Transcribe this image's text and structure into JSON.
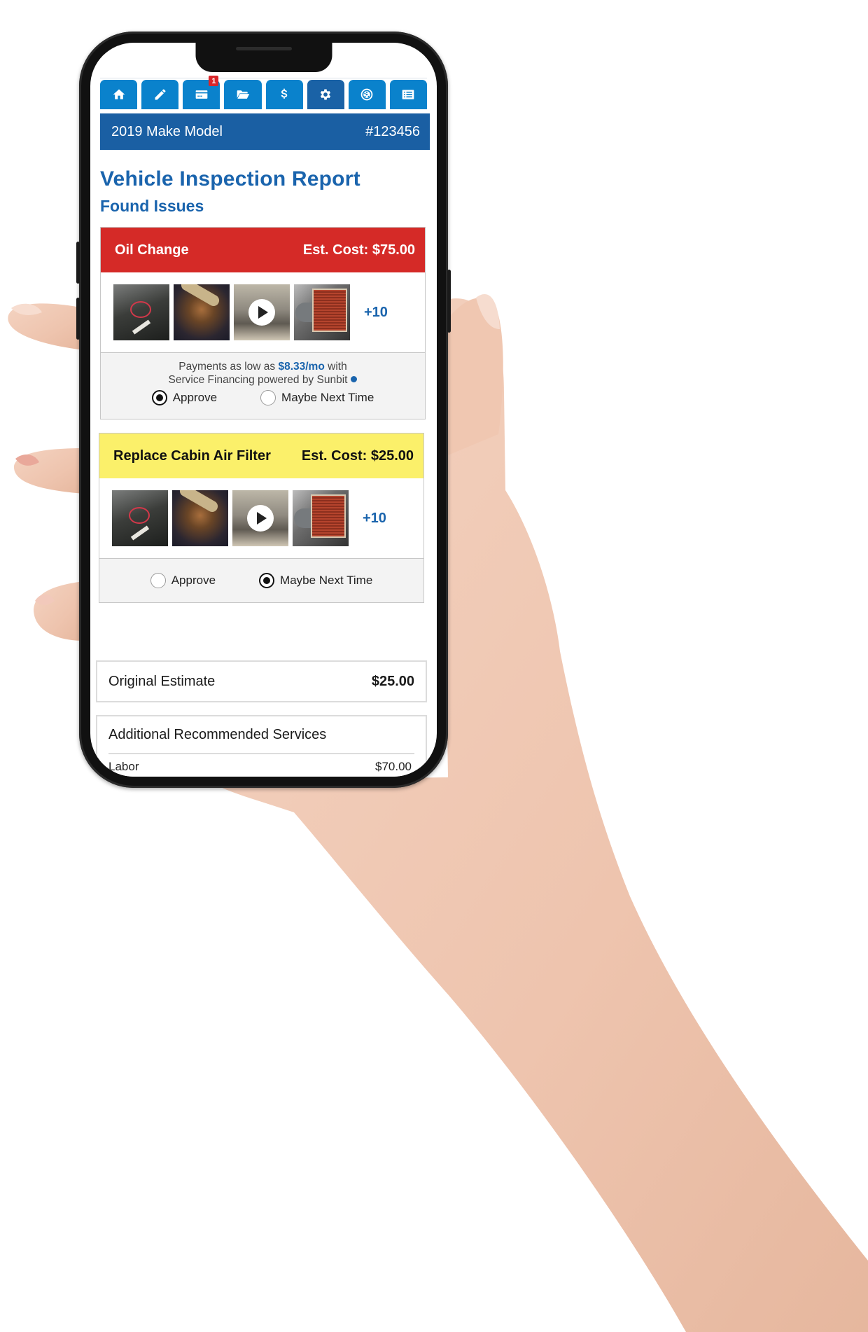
{
  "nav": {
    "tabs": [
      {
        "icon": "home-icon",
        "active": false,
        "badge": null
      },
      {
        "icon": "pencil-icon",
        "active": false,
        "badge": null
      },
      {
        "icon": "credit-card-icon",
        "active": false,
        "badge": "1"
      },
      {
        "icon": "folder-open-icon",
        "active": false,
        "badge": null
      },
      {
        "icon": "dollar-icon",
        "active": false,
        "badge": null
      },
      {
        "icon": "gear-icon",
        "active": true,
        "badge": null
      },
      {
        "icon": "tire-icon",
        "active": false,
        "badge": null
      },
      {
        "icon": "list-icon",
        "active": false,
        "badge": null
      }
    ]
  },
  "vehicle": {
    "name": "2019 Make Model",
    "order_number": "#123456"
  },
  "page": {
    "title": "Vehicle Inspection Report",
    "subtitle": "Found Issues"
  },
  "issues": [
    {
      "name": "Oil Change",
      "cost": "Est. Cost: $75.00",
      "severity": "red",
      "severity_color": "#d52a27",
      "media_more": "+10",
      "financing": {
        "line1_prefix": "Payments as low as",
        "amount": "$8.33/mo",
        "line1_suffix": "with",
        "line2": "Service Financing powered by Sunbit"
      },
      "approve_label": "Approve",
      "decline_label": "Maybe Next Time",
      "selected": "approve"
    },
    {
      "name": "Replace Cabin Air Filter",
      "cost": "Est. Cost: $25.00",
      "severity": "yellow",
      "severity_color": "#fbf06a",
      "media_more": "+10",
      "approve_label": "Approve",
      "decline_label": "Maybe Next Time",
      "selected": "decline"
    }
  ],
  "summary": {
    "original_estimate_label": "Original Estimate",
    "original_estimate_value": "$25.00",
    "additional_title": "Additional Recommended Services",
    "additional_rows": [
      {
        "label": "Labor",
        "value": "$70.00"
      }
    ]
  },
  "colors": {
    "brand_blue": "#0a82cc",
    "header_blue": "#1a5fa3",
    "accent_text": "#1a64ad",
    "badge_red": "#d9262a"
  }
}
